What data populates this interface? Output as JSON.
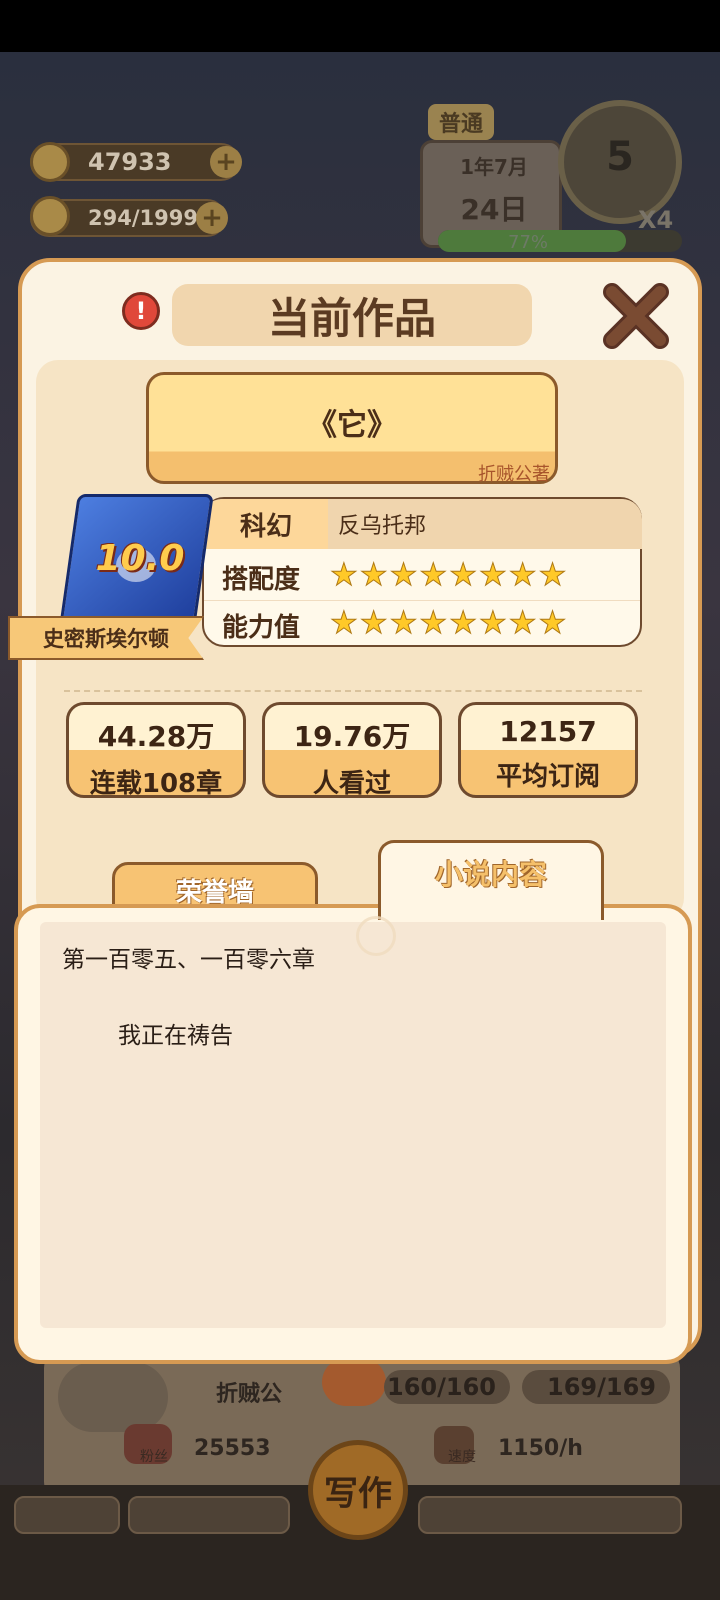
{
  "background": {
    "coins": "47933",
    "energy": "294/1999",
    "difficulty_label": "普通",
    "date_year_month": "1年7月",
    "date_day": "24日",
    "percent": "77%",
    "next_day_number": "5",
    "speed_multiplier": "X4",
    "author_name": "折贼公",
    "stat_a": "160/160",
    "stat_b": "169/169",
    "fans_label": "粉丝",
    "fans_value": "25553",
    "speed_label": "速度",
    "speed_value": "1150/h",
    "write_button": "写作"
  },
  "modal": {
    "title": "当前作品",
    "book": {
      "title": "《它》",
      "author": "折贼公著",
      "score": "10.0",
      "character_name": "史密斯埃尔顿",
      "genre": "科幻",
      "subgenre": "反乌托邦",
      "match_label": "搭配度",
      "match_stars": 8,
      "ability_label": "能力值",
      "ability_stars": 8
    },
    "stats": [
      {
        "value": "44.28万",
        "label": "连载108章"
      },
      {
        "value": "19.76万",
        "label": "人看过"
      },
      {
        "value": "12157",
        "label": "平均订阅"
      }
    ],
    "tabs": {
      "honor_wall": "荣誉墙",
      "novel_content": "小说内容"
    },
    "content": {
      "chapter_title": "第一百零五、一百零六章",
      "chapter_body": "我正在祷告"
    }
  },
  "colors": {
    "panel_border": "#d69a53",
    "title_brown": "#5b3b22",
    "star_yellow": "#ffc928",
    "close_x": "#7a4b32"
  }
}
